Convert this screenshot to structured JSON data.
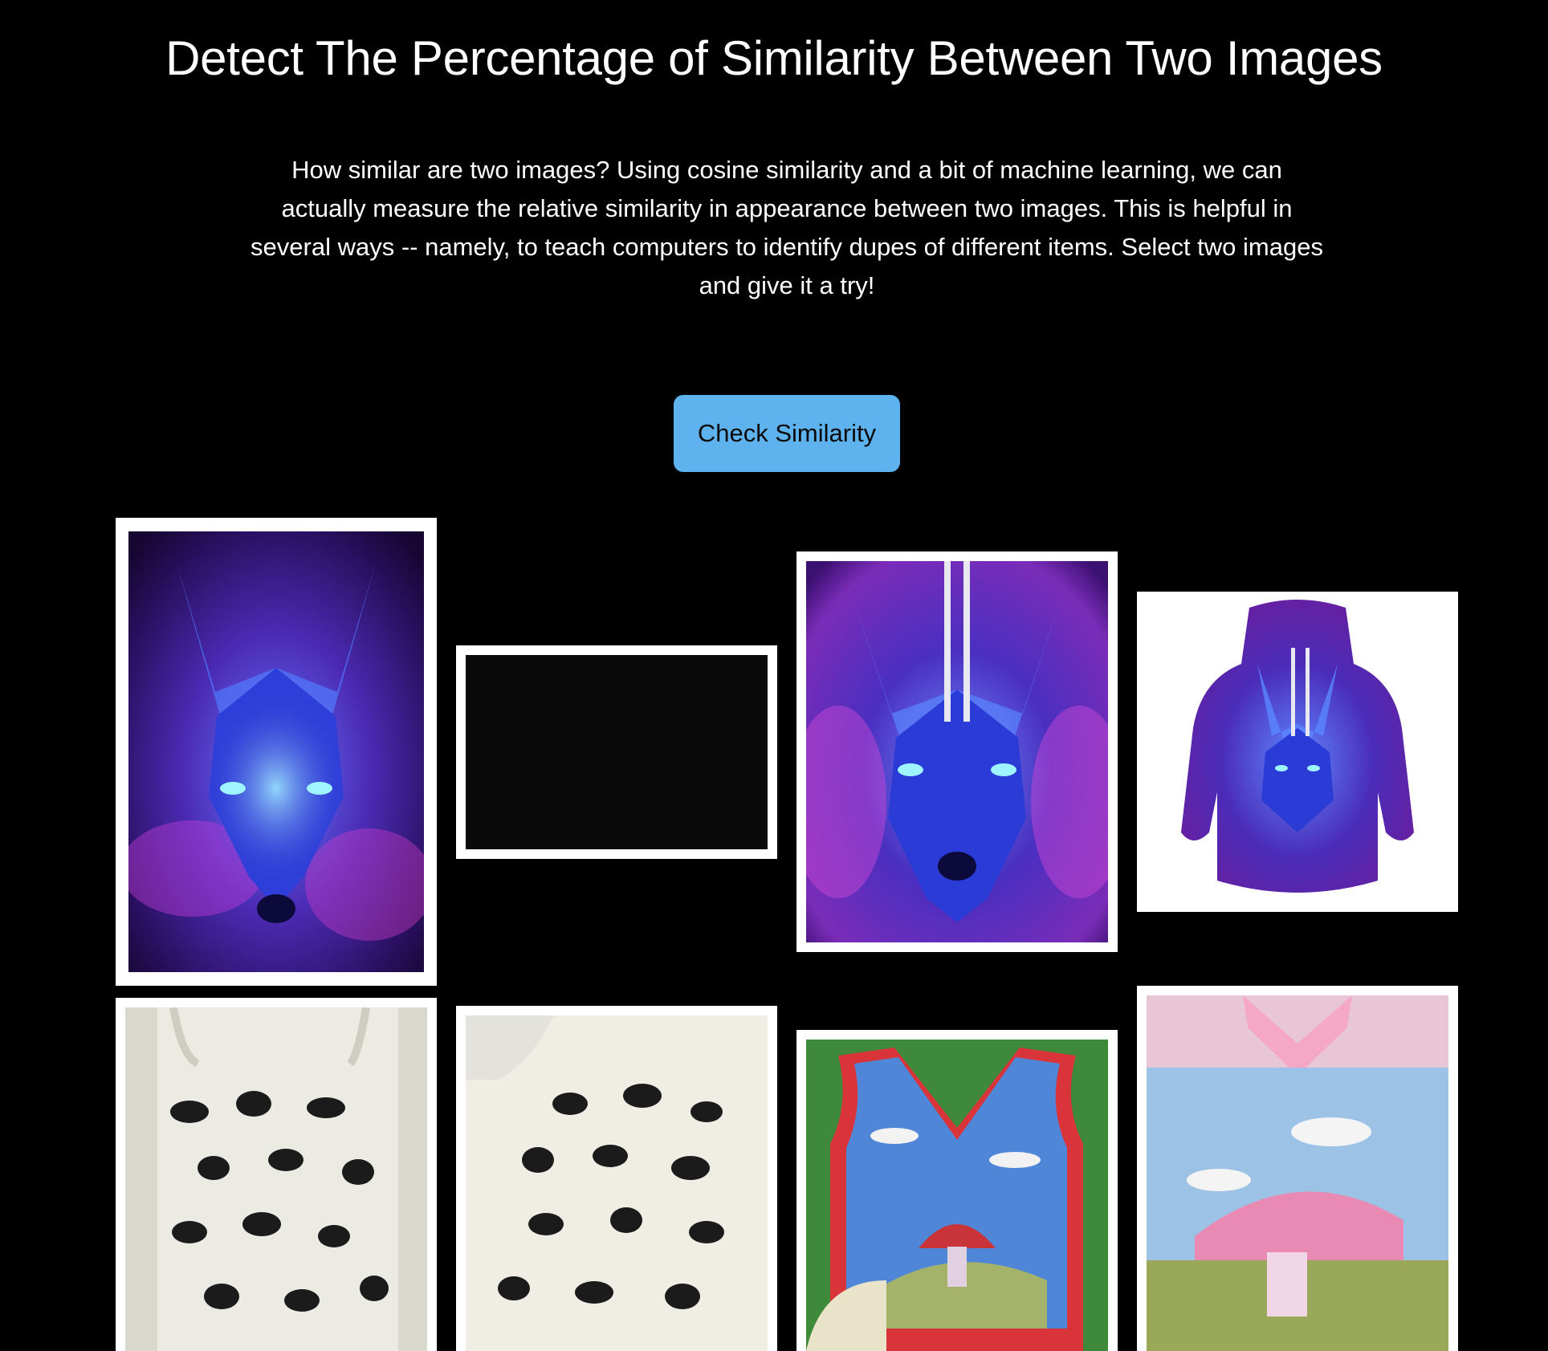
{
  "page": {
    "title": "Detect The Percentage of Similarity Between Two Images",
    "description": "How similar are two images? Using cosine similarity and a bit of machine learning, we can actually measure the relative similarity in appearance between two images. This is helpful in several ways -- namely, to teach computers to identify dupes of different items. Select two images and give it a try!"
  },
  "actions": {
    "check_label": "Check Similarity",
    "button_color": "#5eb3ef"
  },
  "gallery": {
    "items": [
      {
        "name": "galaxy wolf poster",
        "kind": "wolf"
      },
      {
        "name": "black image",
        "kind": "black"
      },
      {
        "name": "galaxy wolf hoodie front",
        "kind": "wolf"
      },
      {
        "name": "galaxy wolf hoodie",
        "kind": "hoodie"
      },
      {
        "name": "cat tote bag",
        "kind": "tote"
      },
      {
        "name": "cat tote bag on shoulder",
        "kind": "tote"
      },
      {
        "name": "mushroom knit vest",
        "kind": "vest"
      },
      {
        "name": "pink mushroom knit vest",
        "kind": "vest"
      }
    ]
  },
  "colors": {
    "background": "#000000",
    "text": "#ffffff",
    "card_border": "#ffffff"
  }
}
